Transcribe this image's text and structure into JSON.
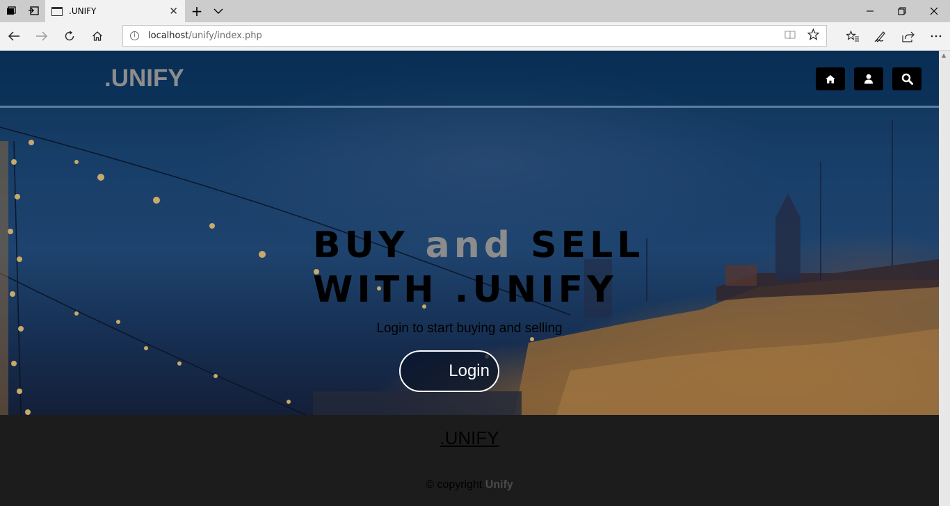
{
  "browser": {
    "tab_title": ".UNIFY",
    "tab_close_glyph": "✕",
    "new_tab_glyph": "+",
    "tab_list_glyph": "⌵",
    "address_host": "localhost",
    "address_path": "/unify/index.php",
    "icons": [
      "set-aside-tabs-icon",
      "restore-tabs-icon",
      "back-icon",
      "forward-icon",
      "refresh-icon",
      "home-icon",
      "reading-view-icon",
      "favorite-star-icon",
      "favorites-hub-icon",
      "pen-icon",
      "share-icon",
      "more-icon",
      "minimize-icon",
      "restore-icon",
      "close-icon"
    ]
  },
  "site": {
    "brand": ".UNIFY",
    "nav_icons": [
      "home-icon",
      "user-icon",
      "search-icon"
    ],
    "headline_word1": "BUY ",
    "headline_accent": "and",
    "headline_word2": " SELL",
    "headline_line2": "WITH .UNIFY",
    "tagline": "Login to start buying and selling",
    "login_label": "Login",
    "footer_brand": ".UNIFY",
    "copyright_prefix": "© copyright ",
    "copyright_name": "Unify"
  },
  "colors": {
    "brand_gray": "#8d8d8d",
    "footer_bg": "#1c1c1c",
    "icon_button_bg": "#000000"
  }
}
